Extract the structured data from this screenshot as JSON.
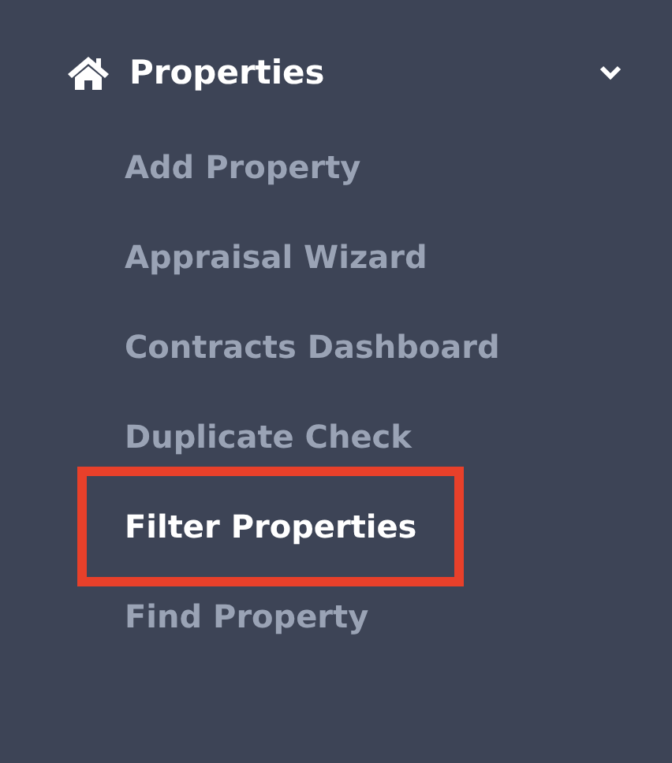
{
  "menu": {
    "label": "Properties",
    "expanded": true,
    "items": [
      {
        "label": "Add Property",
        "selected": false,
        "highlighted": false
      },
      {
        "label": "Appraisal Wizard",
        "selected": false,
        "highlighted": false
      },
      {
        "label": "Contracts Dashboard",
        "selected": false,
        "highlighted": false
      },
      {
        "label": "Duplicate Check",
        "selected": false,
        "highlighted": false
      },
      {
        "label": "Filter Properties",
        "selected": true,
        "highlighted": true
      },
      {
        "label": "Find Property",
        "selected": false,
        "highlighted": false
      }
    ]
  }
}
